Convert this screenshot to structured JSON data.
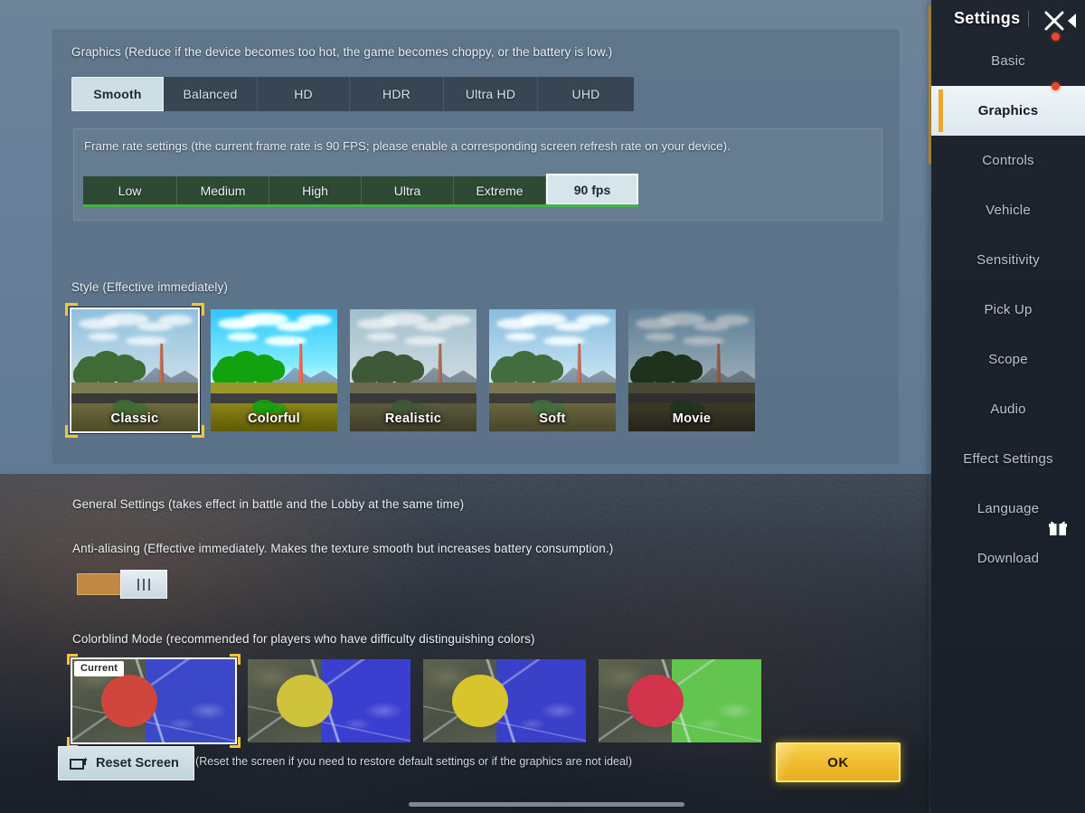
{
  "sidebar": {
    "title": "Settings",
    "close_icon": "close-x-icon",
    "collapse_icon": "collapse-left-arrow-icon",
    "items": [
      {
        "label": "Basic",
        "active": false,
        "dot": true
      },
      {
        "label": "Graphics",
        "active": true,
        "dot": true
      },
      {
        "label": "Controls",
        "active": false,
        "dot": false
      },
      {
        "label": "Vehicle",
        "active": false,
        "dot": false
      },
      {
        "label": "Sensitivity",
        "active": false,
        "dot": false
      },
      {
        "label": "Pick Up",
        "active": false,
        "dot": false
      },
      {
        "label": "Scope",
        "active": false,
        "dot": false
      },
      {
        "label": "Audio",
        "active": false,
        "dot": false
      },
      {
        "label": "Effect Settings",
        "active": false,
        "dot": false
      },
      {
        "label": "Language",
        "active": false,
        "dot": false
      },
      {
        "label": "Download",
        "active": false,
        "dot": false,
        "icon": "gift-icon"
      }
    ]
  },
  "graphics": {
    "section_label": "Graphics (Reduce if the device becomes too hot, the game becomes choppy, or the battery is low.)",
    "quality_options": [
      "Smooth",
      "Balanced",
      "HD",
      "HDR",
      "Ultra HD",
      "UHD"
    ],
    "quality_selected": "Smooth",
    "framerate": {
      "note": "Frame rate settings (the current frame rate is 90 FPS; please enable a corresponding screen refresh rate on your device).",
      "options": [
        "Low",
        "Medium",
        "High",
        "Ultra",
        "Extreme",
        "90 fps"
      ],
      "selected": "90 fps",
      "current_fps": "90 FPS"
    },
    "style": {
      "label": "Style (Effective immediately)",
      "options": [
        {
          "name": "Classic",
          "selected": true
        },
        {
          "name": "Colorful",
          "selected": false
        },
        {
          "name": "Realistic",
          "selected": false
        },
        {
          "name": "Soft",
          "selected": false
        },
        {
          "name": "Movie",
          "selected": false
        }
      ]
    }
  },
  "general": {
    "title": "General Settings (takes effect in battle and the Lobby at the same time)",
    "antialiasing": {
      "label": "Anti-aliasing (Effective immediately. Makes the texture smooth but increases battery consumption.)",
      "enabled": true
    },
    "colorblind": {
      "label": "Colorblind Mode (recommended for players who have difficulty distinguishing colors)",
      "current_badge": "Current",
      "options": [
        {
          "zone_color": "#d0453c",
          "area_color": "#3b49c8",
          "selected": true
        },
        {
          "zone_color": "#cfc23c",
          "area_color": "#3b3fd0",
          "selected": false
        },
        {
          "zone_color": "#d8c52e",
          "area_color": "#3a40c8",
          "selected": false
        },
        {
          "zone_color": "#d0354b",
          "area_color": "#63c450",
          "selected": false
        }
      ]
    }
  },
  "footer": {
    "reset_label": "Reset Screen",
    "reset_icon": "reset-screen-icon",
    "reset_note": "(Reset the screen if you need to restore default settings or if the graphics are not ideal)",
    "ok_label": "OK"
  },
  "colors": {
    "accent_gold": "#e8a72d",
    "ok_button": "#f0bd32",
    "selected_light": "#cddfe5",
    "framerate_green": "#49b04a",
    "notification_red": "#e8492a",
    "toggle_on": "#c08843"
  }
}
